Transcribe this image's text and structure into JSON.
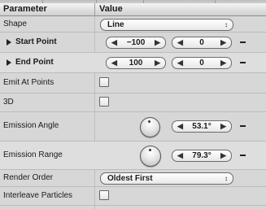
{
  "header": {
    "col_parameter": "Parameter",
    "col_value": "Value"
  },
  "rows": {
    "shape": {
      "label": "Shape",
      "value": "Line"
    },
    "start_point": {
      "label": "Start Point",
      "x": "−100",
      "y": "0"
    },
    "end_point": {
      "label": "End Point",
      "x": "100",
      "y": "0"
    },
    "emit_at_points": {
      "label": "Emit At Points",
      "checked": false
    },
    "three_d": {
      "label": "3D",
      "checked": false
    },
    "emission_angle": {
      "label": "Emission Angle",
      "value": "53.1°"
    },
    "emission_range": {
      "label": "Emission Range",
      "value": "79.3°"
    },
    "render_order": {
      "label": "Render Order",
      "value": "Oldest First"
    },
    "interleave_particles": {
      "label": "Interleave Particles",
      "checked": false
    }
  },
  "glyphs": {
    "left_arrow": "◀",
    "right_arrow": "▶",
    "updown": "↕"
  }
}
